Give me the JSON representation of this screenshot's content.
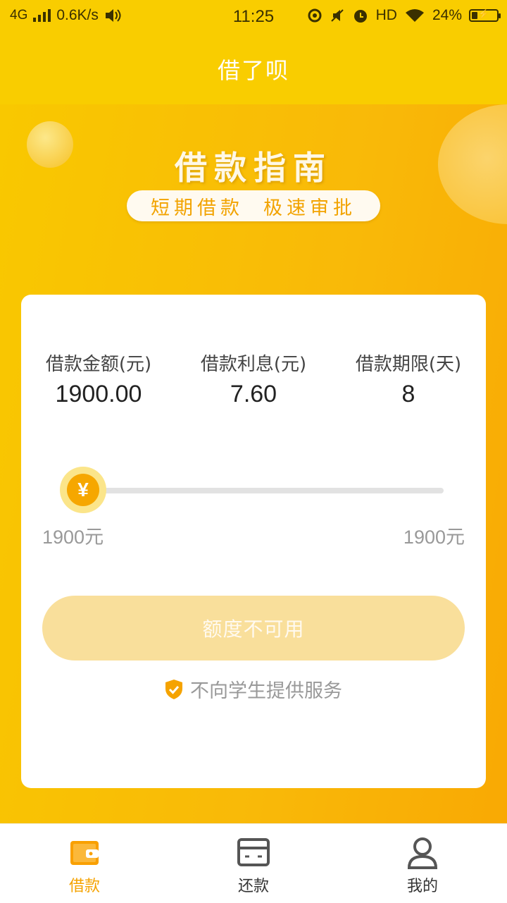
{
  "status_bar": {
    "network": "4G",
    "speed": "0.6K/s",
    "time": "11:25",
    "hd": "HD",
    "battery_percent": "24%",
    "battery_level": 0.24
  },
  "app_bar": {
    "title": "借了呗"
  },
  "banner": {
    "title": "借款指南",
    "tagline_left": "短期借款",
    "tagline_right": "极速审批"
  },
  "loan": {
    "amount_label": "借款金额(元)",
    "amount_value": "1900.00",
    "interest_label": "借款利息(元)",
    "interest_value": "7.60",
    "term_label": "借款期限(天)",
    "term_value": "8",
    "slider_symbol": "¥",
    "range_min": "1900元",
    "range_max": "1900元",
    "button_label": "额度不可用",
    "notice": "不向学生提供服务"
  },
  "colors": {
    "brand_yellow": "#f9cd00",
    "accent_orange": "#f5a300",
    "disabled_button": "#f9df9b"
  },
  "bottom_nav": [
    {
      "label": "借款",
      "icon": "wallet-icon",
      "active": true
    },
    {
      "label": "还款",
      "icon": "card-icon",
      "active": false
    },
    {
      "label": "我的",
      "icon": "user-icon",
      "active": false
    }
  ]
}
